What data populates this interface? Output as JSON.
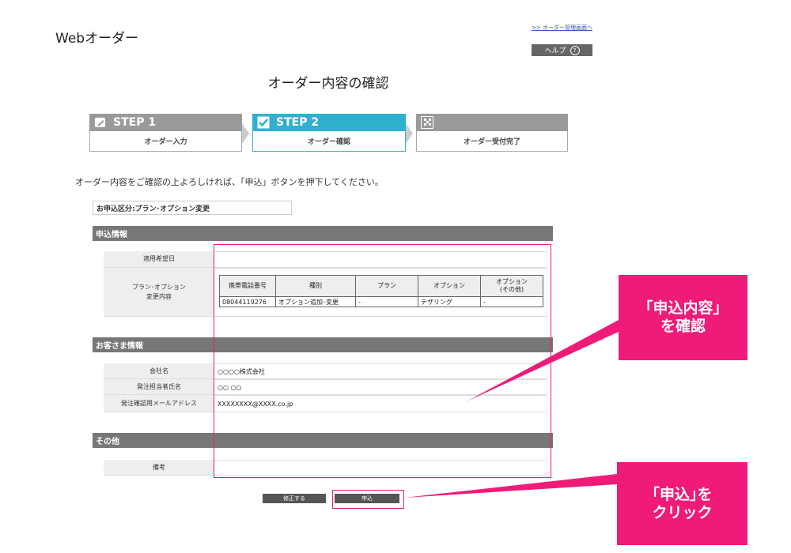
{
  "header": {
    "app_title": "Webオーダー",
    "mgmt_link": ">> オーダー管理画面へ",
    "help_label": "ヘルプ",
    "help_icon": "?"
  },
  "page_title": "オーダー内容の確認",
  "steps": [
    {
      "title": "STEP 1",
      "label": "オーダー入力",
      "icon": "pencil-icon",
      "state": "done"
    },
    {
      "title": "STEP 2",
      "label": "オーダー確認",
      "icon": "check-icon",
      "state": "active"
    },
    {
      "title": "",
      "label": "オーダー受付完了",
      "icon": "flag-icon",
      "state": "pending"
    }
  ],
  "instruction": "オーダー内容をご確認の上よろしければ、「申込」ボタンを押下してください。",
  "category": "お申込区分:プラン･オプション変更",
  "sections": {
    "application": {
      "title": "申込情報",
      "desired_date_label": "適用希望日",
      "desired_date_value": "",
      "change_label_1": "プラン･オプション",
      "change_label_2": "変更内容",
      "table": {
        "headers": [
          "携帯電話番号",
          "種別",
          "プラン",
          "オプション",
          "オプション\n(その他)"
        ],
        "rows": [
          [
            "08044119276",
            "オプション追加･変更",
            "-",
            "テザリング",
            "-"
          ]
        ]
      }
    },
    "customer": {
      "title": "お客さま情報",
      "company_label": "会社名",
      "company_value": "○○○○株式会社",
      "person_label": "発注担当者氏名",
      "person_value": "○○ ○○",
      "email_label": "発注確認用メールアドレス",
      "email_value": "XXXXXXXX@XXXX.co.jp"
    },
    "other": {
      "title": "その他",
      "note_label": "備考",
      "note_value": ""
    }
  },
  "buttons": {
    "edit_label": "修正する",
    "apply_label": "申込"
  },
  "callouts": {
    "confirm_line1": "「申込内容」",
    "confirm_line2": "を確認",
    "click_line1": "｢申込｣を",
    "click_line2": "クリック"
  },
  "colors": {
    "accent": "#2fb0cf",
    "callout": "#f01a78",
    "section_header": "#777777"
  }
}
